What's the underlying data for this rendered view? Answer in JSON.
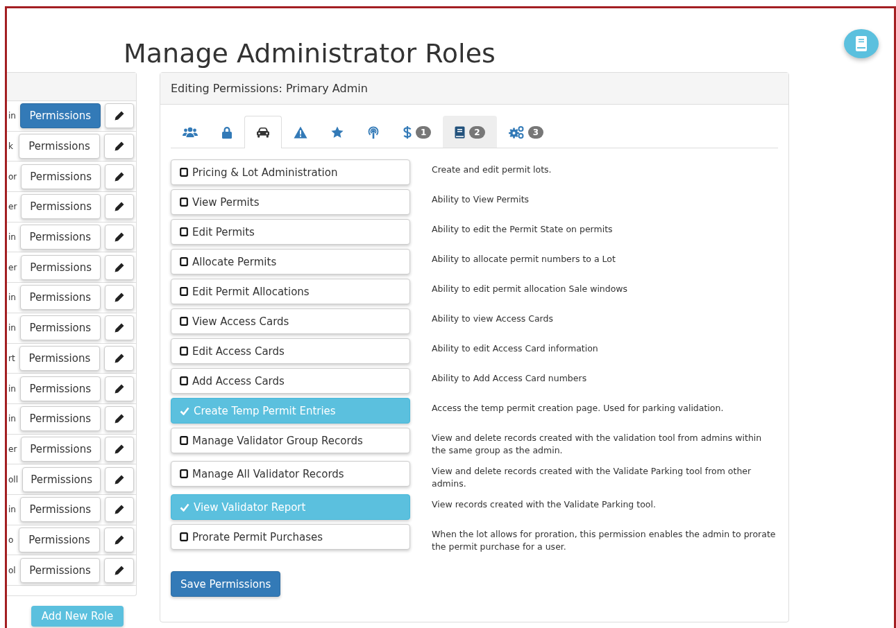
{
  "title": "Manage Administrator Roles",
  "roles": [
    {
      "name": "in",
      "button": "Permissions",
      "selected": true
    },
    {
      "name": "k",
      "button": "Permissions",
      "selected": false
    },
    {
      "name": "or",
      "button": "Permissions",
      "selected": false
    },
    {
      "name": "er",
      "button": "Permissions",
      "selected": false
    },
    {
      "name": "in",
      "button": "Permissions",
      "selected": false
    },
    {
      "name": "er",
      "button": "Permissions",
      "selected": false
    },
    {
      "name": "in",
      "button": "Permissions",
      "selected": false
    },
    {
      "name": "in",
      "button": "Permissions",
      "selected": false
    },
    {
      "name": "rt",
      "button": "Permissions",
      "selected": false
    },
    {
      "name": "in",
      "button": "Permissions",
      "selected": false
    },
    {
      "name": "in",
      "button": "Permissions",
      "selected": false
    },
    {
      "name": "er",
      "button": "Permissions",
      "selected": false
    },
    {
      "name": "oll",
      "button": "Permissions",
      "selected": false
    },
    {
      "name": "in",
      "button": "Permissions",
      "selected": false
    },
    {
      "name": "o",
      "button": "Permissions",
      "selected": false
    },
    {
      "name": "ol",
      "button": "Permissions",
      "selected": false
    }
  ],
  "add_role_button": "Add New Role",
  "editor": {
    "heading": "Editing Permissions: Primary Admin",
    "tabs": [
      {
        "kind": "users",
        "selected": false,
        "highlighted": false
      },
      {
        "kind": "lock",
        "selected": false,
        "highlighted": false
      },
      {
        "kind": "car",
        "selected": true,
        "highlighted": false
      },
      {
        "kind": "warning",
        "selected": false,
        "highlighted": false
      },
      {
        "kind": "star",
        "selected": false,
        "highlighted": false
      },
      {
        "kind": "broadcast",
        "selected": false,
        "highlighted": false
      },
      {
        "kind": "dollar",
        "selected": false,
        "highlighted": false,
        "badge": "1"
      },
      {
        "kind": "book",
        "selected": false,
        "highlighted": true,
        "badge": "2"
      },
      {
        "kind": "gears",
        "selected": false,
        "highlighted": false,
        "badge": "3"
      }
    ],
    "permissions": [
      {
        "label": "Pricing & Lot Administration",
        "checked": false,
        "description": "Create and edit permit lots."
      },
      {
        "label": "View Permits",
        "checked": false,
        "description": "Ability to View Permits"
      },
      {
        "label": "Edit Permits",
        "checked": false,
        "description": "Ability to edit the Permit State on permits"
      },
      {
        "label": "Allocate Permits",
        "checked": false,
        "description": "Ability to allocate permit numbers to a Lot"
      },
      {
        "label": "Edit Permit Allocations",
        "checked": false,
        "description": "Ability to edit permit allocation Sale windows"
      },
      {
        "label": "View Access Cards",
        "checked": false,
        "description": "Ability to view Access Cards"
      },
      {
        "label": "Edit Access Cards",
        "checked": false,
        "description": "Ability to edit Access Card information"
      },
      {
        "label": "Add Access Cards",
        "checked": false,
        "description": "Ability to Add Access Card numbers"
      },
      {
        "label": "Create Temp Permit Entries",
        "checked": true,
        "description": "Access the temp permit creation page. Used for parking validation."
      },
      {
        "label": "Manage Validator Group Records",
        "checked": false,
        "description": "View and delete records created with the validation tool from admins within the same group as the admin."
      },
      {
        "label": "Manage All Validator Records",
        "checked": false,
        "description": "View and delete records created with the Validate Parking tool from other admins."
      },
      {
        "label": "View Validator Report",
        "checked": true,
        "description": "View records created with the Validate Parking tool."
      },
      {
        "label": "Prorate Permit Purchases",
        "checked": false,
        "description": "When the lot allows for proration, this permission enables the admin to prorate the permit purchase for a user."
      }
    ],
    "save_button": "Save Permissions"
  }
}
